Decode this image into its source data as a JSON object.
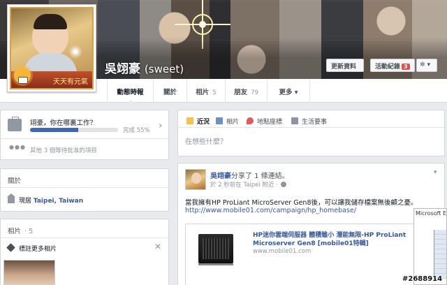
{
  "profile": {
    "name": "吳翊豪",
    "alt_name": "(sweet)",
    "picture_caption": "天天有元氣"
  },
  "header_buttons": {
    "update_info": "更新資料",
    "activity_log": "活動紀錄",
    "activity_count": "3",
    "gear_label": "✲ ▾"
  },
  "tabs": [
    {
      "label": "動態時報",
      "count": ""
    },
    {
      "label": "關於",
      "count": ""
    },
    {
      "label": "相片",
      "count": "5"
    },
    {
      "label": "朋友",
      "count": "79"
    },
    {
      "label": "更多 ▾",
      "count": ""
    }
  ],
  "work_prompt": {
    "question": "翊豪，你在哪裏工作？",
    "progress_percent": 55,
    "progress_label": "完成 55%",
    "pending_text": "其他 3 個等待批准的項目"
  },
  "about": {
    "title": "關於",
    "lives_in_prefix": "現居 ",
    "lives_in_place": "Taipei, Taiwan"
  },
  "photos": {
    "title": "相片",
    "count": "· 5",
    "tag_more": "標註更多相片"
  },
  "composer": {
    "tabs": [
      "近況",
      "相片",
      "地點座標",
      "生活要事"
    ],
    "placeholder": "在想些什麼？"
  },
  "post": {
    "author": "吳翊豪",
    "action": "分享了 1 條連結。",
    "meta": "於 2 秒前在 Taipei 附近 ·",
    "caret": "▾",
    "text": "當我擁有HP ProLiant MicroServer Gen8後，可以讓我儲存檔案無後顧之憂。",
    "link": "http://www.mobile01.com/campaign/hp_homebase/",
    "share_title": "HP迷你雲端伺服器 體積雖小 潛能無限-HP ProLiant Microserver Gen8 [mobile01特輯]",
    "share_host": "www.mobile01.com"
  },
  "overlay": {
    "popup_title": "Microsoft Exc",
    "watermark": "#2688914"
  }
}
